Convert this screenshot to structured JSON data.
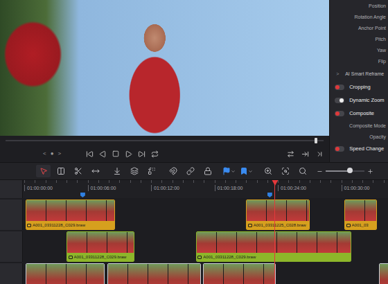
{
  "viewer": {
    "clip_nav": [
      "<",
      "●",
      ">"
    ],
    "scrub_level": 0.975
  },
  "inspector": {
    "items": [
      {
        "kind": "property",
        "label": "Position"
      },
      {
        "kind": "property",
        "label": "Rotation Angle"
      },
      {
        "kind": "property",
        "label": "Anchor Point"
      },
      {
        "kind": "property",
        "label": "Pitch"
      },
      {
        "kind": "property",
        "label": "Yaw"
      },
      {
        "kind": "property",
        "label": "Flip"
      },
      {
        "kind": "section",
        "label": "AI Smart Reframe",
        "chevron": ">",
        "expanded": false
      },
      {
        "kind": "toggle",
        "label": "Cropping",
        "on": true
      },
      {
        "kind": "toggle",
        "label": "Dynamic Zoom",
        "on": false
      },
      {
        "kind": "toggle",
        "label": "Composite",
        "on": true
      },
      {
        "kind": "property",
        "label": "Composite Mode"
      },
      {
        "kind": "property",
        "label": "Opacity"
      },
      {
        "kind": "toggle",
        "label": "Speed Change",
        "on": true
      }
    ]
  },
  "toolbar": {
    "tools": [
      {
        "selected": true
      },
      {
        "selected": false
      },
      {
        "selected": false
      },
      {
        "selected": false
      },
      {
        "selected": false
      },
      {
        "selected": false
      },
      {
        "selected": false
      },
      {
        "selected": false
      },
      {
        "selected": false
      },
      {
        "selected": false
      },
      {
        "selected": false
      },
      {
        "selected": false
      },
      {
        "selected": false
      },
      {
        "selected": false
      },
      {
        "selected": false
      }
    ],
    "zoom": {
      "level": 0.62
    }
  },
  "timeline": {
    "ruler": [
      {
        "label": "01:00:00:00",
        "seconds": 0
      },
      {
        "label": "01:00:06:00",
        "seconds": 6
      },
      {
        "label": "01:00:12:00",
        "seconds": 12
      },
      {
        "label": "01:00:18:00",
        "seconds": 18
      },
      {
        "label": "01:00:24:00",
        "seconds": 24
      },
      {
        "label": "01:00:30:00",
        "seconds": 30
      }
    ],
    "playhead_seconds": 23.7,
    "markers": [
      {
        "seconds": 5.5,
        "color": "#2f7fe0"
      },
      {
        "seconds": 23.2,
        "color": "#2f7fe0"
      }
    ],
    "tracks": [
      {
        "clips": [
          {
            "label": "A001_03311228_C029.braw",
            "start": 0.1,
            "duration": 8.5,
            "color": "#d6a01e"
          },
          {
            "label": "A001_03311225_C028.braw",
            "start": 21.0,
            "duration": 6.0,
            "color": "#d6a01e"
          },
          {
            "label": "A001_03",
            "start": 30.3,
            "duration": 3.1,
            "color": "#d6a01e"
          }
        ]
      },
      {
        "clips": [
          {
            "label": "A001_03311228_C029.braw",
            "start": 4.0,
            "duration": 6.4,
            "color": "#8db62a"
          },
          {
            "label": "A001_03311228_C029.braw",
            "start": 16.25,
            "duration": 14.7,
            "color": "#8db62a"
          }
        ]
      },
      {
        "clips": [
          {
            "start": 0.1,
            "duration": 7.5,
            "color": "#c9ccd4"
          },
          {
            "start": 7.9,
            "duration": 8.8,
            "color": "#c9ccd4"
          },
          {
            "start": 16.9,
            "duration": 6.9,
            "color": "#c9ccd4"
          },
          {
            "start": 33.6,
            "duration": 2.0,
            "color": "#c9ccd4"
          }
        ]
      }
    ]
  }
}
